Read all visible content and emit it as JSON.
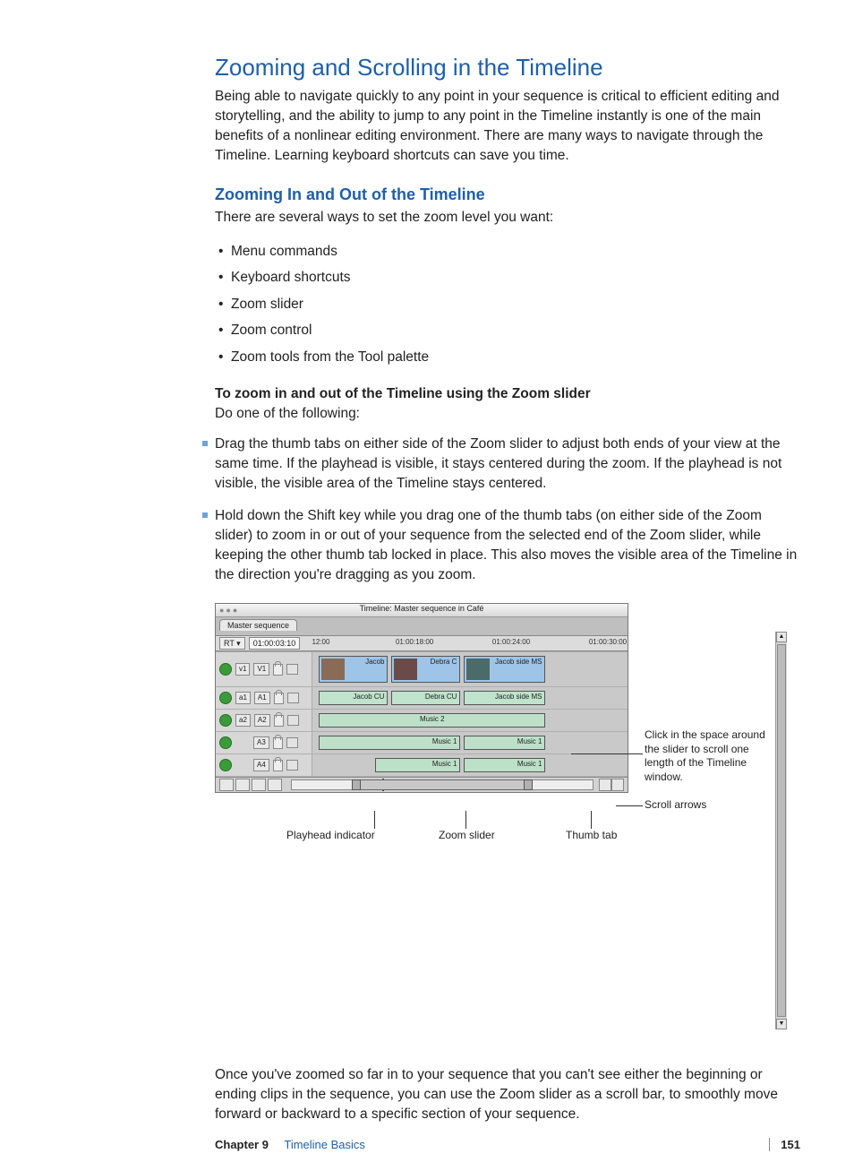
{
  "heading": "Zooming and Scrolling in the Timeline",
  "intro": "Being able to navigate quickly to any point in your sequence is critical to efficient editing and storytelling, and the ability to jump to any point in the Timeline instantly is one of the main benefits of a nonlinear editing environment. There are many ways to navigate through the Timeline. Learning keyboard shortcuts can save you time.",
  "subheading": "Zooming In and Out of the Timeline",
  "sub_intro": "There are several ways to set the zoom level you want:",
  "methods": [
    "Menu commands",
    "Keyboard shortcuts",
    "Zoom slider",
    "Zoom control",
    "Zoom tools from the Tool palette"
  ],
  "step_head": "To zoom in and out of the Timeline using the Zoom slider",
  "step_lead": "Do one of the following:",
  "steps": [
    "Drag the thumb tabs on either side of the Zoom slider to adjust both ends of your view at the same time. If the playhead is visible, it stays centered during the zoom. If the playhead is not visible, the visible area of the Timeline stays centered.",
    "Hold down the Shift key while you drag one of the thumb tabs (on either side of the Zoom slider) to zoom in or out of your sequence from the selected end of the Zoom slider, while keeping the other thumb tab locked in place. This also moves the visible area of the Timeline in the direction you're dragging as you zoom."
  ],
  "timeline": {
    "title": "Timeline: Master sequence in Café",
    "tab": "Master sequence",
    "rt_label": "RT ▾",
    "timecode": "01:00:03:10",
    "ruler_marks": [
      "12:00",
      "01:00:18:00",
      "01:00:24:00",
      "01:00:30:00"
    ],
    "tracks": {
      "v1": {
        "labels": [
          "v1",
          "V1"
        ],
        "clips": [
          "Jacob",
          "Debra C",
          "Jacob side MS"
        ]
      },
      "a1": {
        "labels": [
          "a1",
          "A1"
        ],
        "clips": [
          "Jacob CU",
          "Debra CU",
          "Jacob side MS"
        ]
      },
      "a2": {
        "labels": [
          "a2",
          "A2"
        ],
        "clips": [
          "Music 2"
        ]
      },
      "a3": {
        "labels": [
          "A3"
        ],
        "clips": [
          "Music 1",
          "Music 1"
        ]
      },
      "a4": {
        "labels": [
          "A4"
        ],
        "clips": [
          "Music 1",
          "Music 1"
        ]
      }
    }
  },
  "callouts": {
    "side1": "Click in the space around the slider to scroll one length of the Timeline window.",
    "side2": "Scroll arrows",
    "b1": "Playhead indicator",
    "b2": "Zoom slider",
    "b3": "Thumb tab"
  },
  "closing": "Once you've zoomed so far in to your sequence that you can't see either the beginning or ending clips in the sequence, you can use the Zoom slider as a scroll bar, to smoothly move forward or backward to a specific section of your sequence.",
  "footer": {
    "chapter": "Chapter 9",
    "title": "Timeline Basics",
    "page": "151"
  }
}
